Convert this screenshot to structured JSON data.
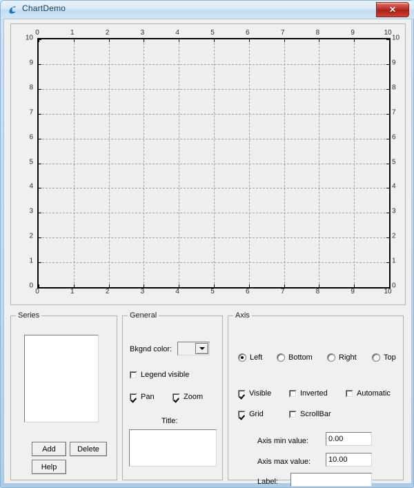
{
  "window": {
    "title": "ChartDemo",
    "icon": "swan-app-icon",
    "close_label": "✕"
  },
  "chart_data": {
    "type": "line",
    "title": "",
    "xlabel": "",
    "ylabel": "",
    "series": [],
    "x_ticks": [
      "0",
      "1",
      "2",
      "3",
      "4",
      "5",
      "6",
      "7",
      "8",
      "9",
      "10"
    ],
    "y_ticks": [
      "0",
      "1",
      "2",
      "3",
      "4",
      "5",
      "6",
      "7",
      "8",
      "9",
      "10"
    ],
    "xlim": [
      0,
      10
    ],
    "ylim": [
      0,
      10
    ],
    "grid": true,
    "grid_style": "dashed",
    "grid_color": "#a0a0a0",
    "axis_color": "#000000",
    "plot_background": "#efefef",
    "axes_shown": [
      "top",
      "bottom",
      "left",
      "right"
    ],
    "legend_visible": false
  },
  "series_group": {
    "title": "Series",
    "list_items": [],
    "add_label": "Add",
    "delete_label": "Delete",
    "help_label": "Help"
  },
  "general_group": {
    "title": "General",
    "bkgnd_color_label": "Bkgnd color:",
    "bkgnd_color_value": "",
    "legend_visible_label": "Legend visible",
    "legend_visible_checked": false,
    "pan_label": "Pan",
    "pan_checked": true,
    "zoom_label": "Zoom",
    "zoom_checked": true,
    "title_label": "Title:",
    "title_value": ""
  },
  "axis_group": {
    "title": "Axis",
    "radios": [
      {
        "label": "Left",
        "selected": true
      },
      {
        "label": "Bottom",
        "selected": false
      },
      {
        "label": "Right",
        "selected": false
      },
      {
        "label": "Top",
        "selected": false
      }
    ],
    "checkboxes": [
      {
        "label": "Visible",
        "checked": true
      },
      {
        "label": "Inverted",
        "checked": false
      },
      {
        "label": "Automatic",
        "checked": false
      },
      {
        "label": "Grid",
        "checked": true
      },
      {
        "label": "ScrollBar",
        "checked": false
      }
    ],
    "min_label": "Axis min value:",
    "min_value": "0.00",
    "max_label": "Axis max value:",
    "max_value": "10.00",
    "label_label": "Label:",
    "label_value": ""
  }
}
